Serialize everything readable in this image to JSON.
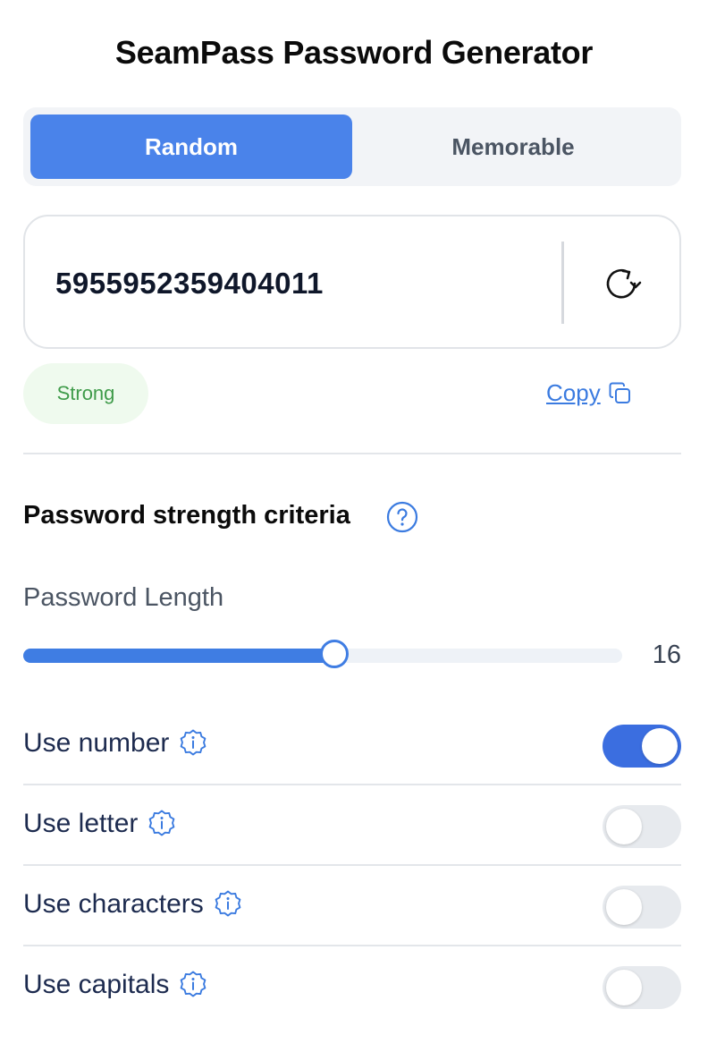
{
  "app": {
    "title": "SeamPass Password Generator"
  },
  "mode_tabs": [
    {
      "label": "Random",
      "selected": true
    },
    {
      "label": "Memorable",
      "selected": false
    }
  ],
  "password": {
    "value": "5955952359404011",
    "strength": "Strong",
    "copy_label": "Copy"
  },
  "criteria": {
    "heading": "Password strength criteria",
    "length_label": "Password Length",
    "length_value": "16",
    "length_fraction": 0.52,
    "options": [
      {
        "label": "Use number",
        "enabled": true
      },
      {
        "label": "Use letter",
        "enabled": false
      },
      {
        "label": "Use characters",
        "enabled": false
      },
      {
        "label": "Use capitals",
        "enabled": false
      }
    ]
  },
  "colors": {
    "accent": "#4a83ea",
    "toggle_on": "#3b6ee0",
    "strength_text": "#3f9b4a",
    "strength_bg": "#effaee",
    "link": "#3b7be0"
  },
  "icons": {
    "refresh": "refresh-icon",
    "copy": "copy-icon",
    "help": "help-circle-icon",
    "info": "info-badge-icon"
  }
}
